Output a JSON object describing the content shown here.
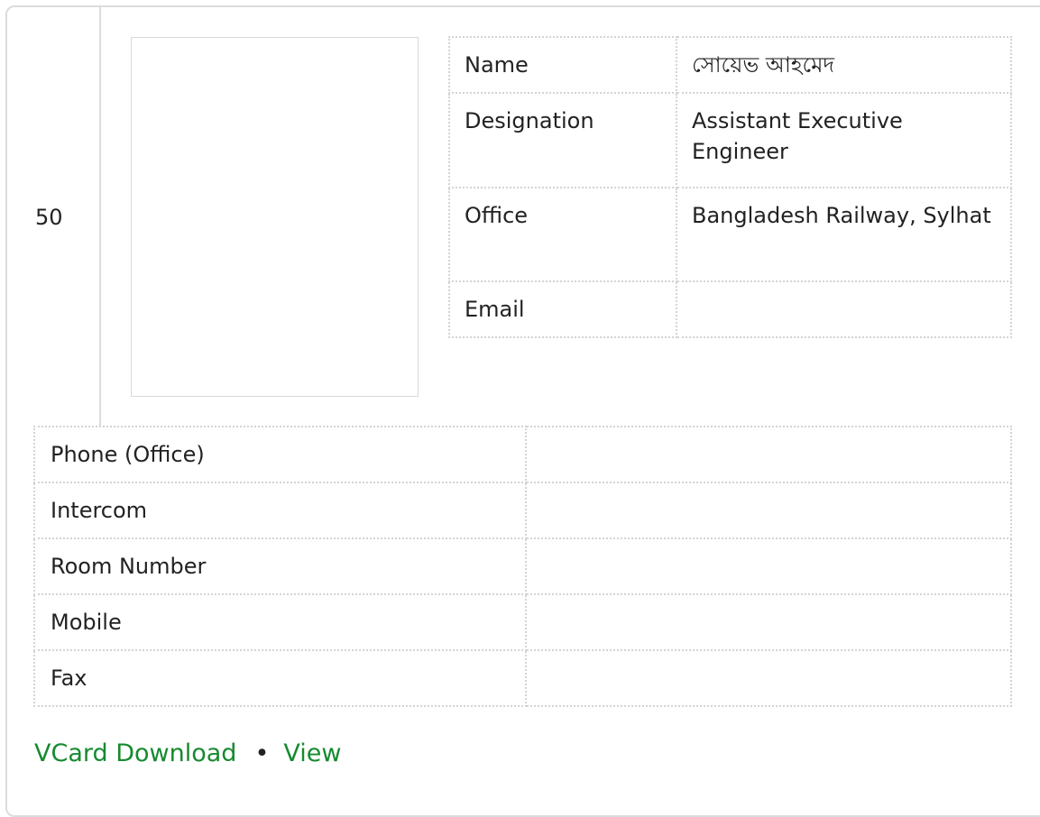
{
  "serial": "50",
  "profile": {
    "rows": [
      {
        "label": "Name",
        "value": "সোয়েভ আহমেদ"
      },
      {
        "label": "Designation",
        "value": "Assistant Executive Engineer"
      },
      {
        "label": "Office",
        "value": "Bangladesh Railway, Sylhat"
      },
      {
        "label": "Email",
        "value": ""
      }
    ]
  },
  "contact": {
    "rows": [
      {
        "label": "Phone (Office)",
        "value": ""
      },
      {
        "label": "Intercom",
        "value": ""
      },
      {
        "label": "Room Number",
        "value": ""
      },
      {
        "label": "Mobile",
        "value": ""
      },
      {
        "label": "Fax",
        "value": ""
      }
    ]
  },
  "links": {
    "vcard_label": "VCard Download",
    "separator": "•",
    "view_label": "View",
    "link_color": "#168a2f"
  }
}
